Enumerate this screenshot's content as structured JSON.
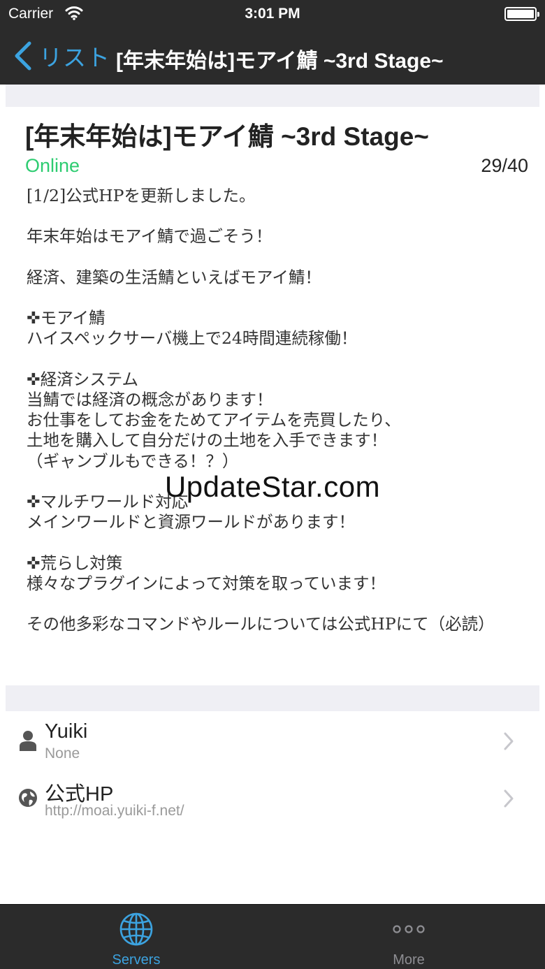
{
  "status_bar": {
    "carrier": "Carrier",
    "time": "3:01 PM"
  },
  "nav": {
    "back_label": "リスト",
    "title": "[年末年始は]モアイ鯖 ~3rd Stage~"
  },
  "server": {
    "title": "[年末年始は]モアイ鯖 ~3rd Stage~",
    "status": "Online",
    "players": "29/40",
    "motd": "[1/2]公式HPを更新しました。\n\n年末年始はモアイ鯖で過ごそう！\n\n経済、建築の生活鯖といえばモアイ鯖！\n\n✜モアイ鯖\nハイスペックサーバ機上で24時間連続稼働！\n\n✜経済システム\n当鯖では経済の概念があります！\nお仕事をしてお金をためてアイテムを売買したり、\n土地を購入して自分だけの土地を入手できます！\n（ギャンブルもできる！？）\n\n✜マルチワールド対応\nメインワールドと資源ワールドがあります！\n\n✜荒らし対策\n様々なプラグインによって対策を取っています！\n\nその他多彩なコマンドやルールについては公式HPにて（必読）"
  },
  "watermark": "UpdateStar.com",
  "rows": [
    {
      "title": "Yuiki",
      "subtitle": "None",
      "icon": "person-icon"
    },
    {
      "title": "公式HP",
      "subtitle": "http://moai.yuiki-f.net/",
      "icon": "globe-icon"
    }
  ],
  "tabs": [
    {
      "label": "Servers",
      "icon": "globe-icon",
      "selected": true
    },
    {
      "label": "More",
      "icon": "more-icon",
      "selected": false
    }
  ],
  "colors": {
    "accent": "#3ca3e0",
    "online": "#2ecc71",
    "bar": "#2b2b2b"
  }
}
